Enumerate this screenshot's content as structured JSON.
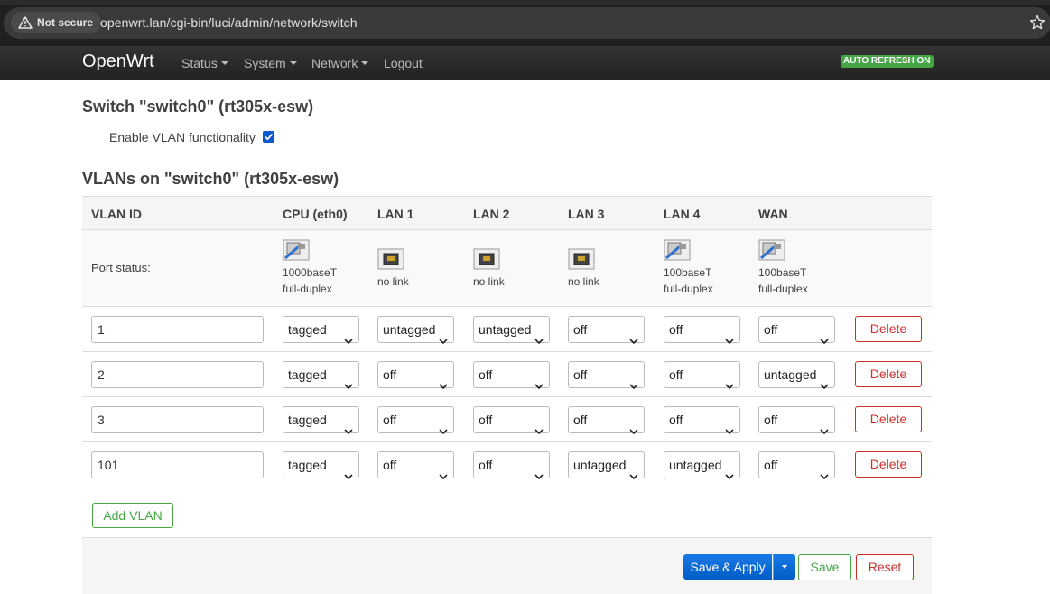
{
  "browser": {
    "security_label": "Not secure",
    "url": "openwrt.lan/cgi-bin/luci/admin/network/switch"
  },
  "navbar": {
    "brand": "OpenWrt",
    "items": [
      {
        "label": "Status",
        "dropdown": true
      },
      {
        "label": "System",
        "dropdown": true
      },
      {
        "label": "Network",
        "dropdown": true
      },
      {
        "label": "Logout",
        "dropdown": false
      }
    ],
    "auto_refresh": "AUTO REFRESH ON"
  },
  "switch_section": {
    "title": "Switch \"switch0\" (rt305x-esw)",
    "enable_vlan_label": "Enable VLAN functionality",
    "enable_vlan_checked": true
  },
  "vlans_section": {
    "title": "VLANs on \"switch0\" (rt305x-esw)",
    "headers": [
      "VLAN ID",
      "CPU (eth0)",
      "LAN 1",
      "LAN 2",
      "LAN 3",
      "LAN 4",
      "WAN"
    ],
    "port_status_label": "Port status:",
    "ports": [
      {
        "icon": "port-link-icon",
        "line1": "1000baseT",
        "line2": "full-duplex"
      },
      {
        "icon": "port-nolink-icon",
        "line1": "no link",
        "line2": ""
      },
      {
        "icon": "port-nolink-icon",
        "line1": "no link",
        "line2": ""
      },
      {
        "icon": "port-nolink-icon",
        "line1": "no link",
        "line2": ""
      },
      {
        "icon": "port-link-icon",
        "line1": "100baseT",
        "line2": "full-duplex"
      },
      {
        "icon": "port-link-icon",
        "line1": "100baseT",
        "line2": "full-duplex"
      }
    ],
    "rows": [
      {
        "vlan_id": "1",
        "ports": [
          "tagged",
          "untagged",
          "untagged",
          "off",
          "off",
          "off"
        ],
        "delete_label": "Delete"
      },
      {
        "vlan_id": "2",
        "ports": [
          "tagged",
          "off",
          "off",
          "off",
          "off",
          "untagged"
        ],
        "delete_label": "Delete"
      },
      {
        "vlan_id": "3",
        "ports": [
          "tagged",
          "off",
          "off",
          "off",
          "off",
          "off"
        ],
        "delete_label": "Delete"
      },
      {
        "vlan_id": "101",
        "ports": [
          "tagged",
          "off",
          "off",
          "untagged",
          "untagged",
          "off"
        ],
        "delete_label": "Delete"
      }
    ],
    "add_vlan_label": "Add VLAN"
  },
  "footer": {
    "save_apply_label": "Save & Apply",
    "save_label": "Save",
    "reset_label": "Reset"
  },
  "colors": {
    "navbar": "#2a2a2a",
    "primary": "#0069d9",
    "positive": "#46a546",
    "negative": "#c9302c",
    "checkbox": "#0b57d0"
  }
}
